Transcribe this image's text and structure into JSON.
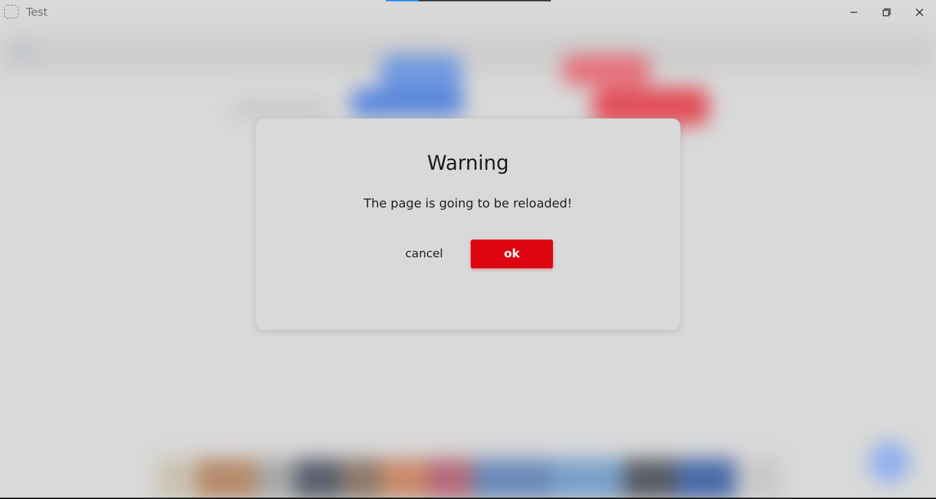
{
  "window": {
    "title": "Test",
    "loading_progress": 0.2
  },
  "dialog": {
    "title": "Warning",
    "message": "The page is going to be reloaded!",
    "cancel_label": "cancel",
    "ok_label": "ok"
  },
  "colors": {
    "ok_button": "#dc0510",
    "progress_fill": "#2a8ff0",
    "progress_track": "#3c3c3c",
    "dialog_background": "#d9d9d9"
  }
}
